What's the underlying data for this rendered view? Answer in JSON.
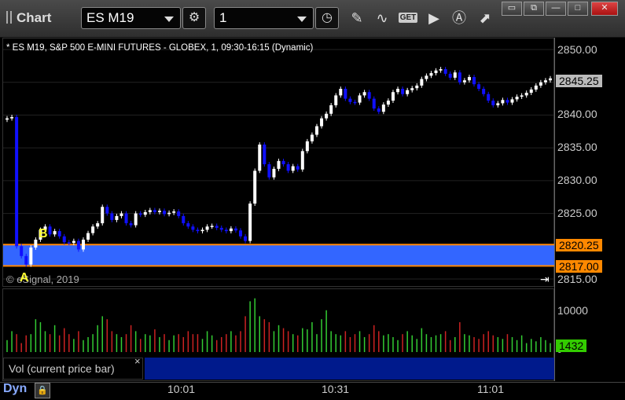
{
  "app": {
    "title": "Chart"
  },
  "toolbar": {
    "symbol": "ES M19",
    "interval": "1",
    "get_label": "GET"
  },
  "chart": {
    "description": "* ES M19, S&P 500 E-MINI FUTURES - GLOBEX, 1, 09:30-16:15 (Dynamic)",
    "copyright": "© eSignal, 2019",
    "price_ticks": [
      "2850.00",
      "2845.00",
      "2840.00",
      "2835.00",
      "2830.00",
      "2825.00",
      "2820.00",
      "2815.00"
    ],
    "last_price": "2845.25",
    "upper_band_price": "2820.25",
    "lower_band_price": "2817.00",
    "label_a": "A",
    "label_b": "B",
    "colors": {
      "up_candle": "#ffffff",
      "down_candle": "#1010ff",
      "band_fill": "#3366ff",
      "band_line": "#ff8800",
      "last_price_tag": "#bbbbbb",
      "band_tag": "#ff8800"
    }
  },
  "volume": {
    "label": "Vol (current price bar)",
    "close_icon": "×",
    "ticks": [
      "10000",
      "0"
    ],
    "current_value": "1432",
    "colors": {
      "up": "#33cc33",
      "down": "#cc2222",
      "current_tag": "#33cc00"
    }
  },
  "time_axis": {
    "labels": [
      "10:01",
      "10:31",
      "11:01"
    ]
  },
  "bottom": {
    "mode": "Dyn"
  },
  "chart_data": {
    "type": "candlestick",
    "y_range": [
      2815,
      2850
    ],
    "interval_minutes": 1,
    "closes": [
      2839.5,
      2839.7,
      2820,
      2818.5,
      2817.2,
      2819.8,
      2821,
      2822.5,
      2823,
      2821.8,
      2822.3,
      2821.5,
      2820.6,
      2820.5,
      2820.8,
      2819.5,
      2821,
      2822,
      2823,
      2823.5,
      2826,
      2825,
      2824,
      2824.6,
      2825,
      2823.5,
      2823.2,
      2825,
      2824.8,
      2825.2,
      2825.5,
      2825.2,
      2825.4,
      2824.9,
      2825.1,
      2825.3,
      2824.6,
      2823.5,
      2823,
      2822.5,
      2822.3,
      2822.5,
      2823,
      2823.1,
      2822.8,
      2822.5,
      2822.3,
      2822.7,
      2822.4,
      2821.5,
      2820.8,
      2826.5,
      2831.5,
      2835.5,
      2832.5,
      2830.5,
      2831.8,
      2833,
      2832.5,
      2831.5,
      2832.2,
      2831.7,
      2834.5,
      2836,
      2837,
      2838.3,
      2839.5,
      2840.2,
      2841.5,
      2843,
      2844,
      2842.5,
      2842,
      2841.9,
      2843,
      2843.5,
      2842.5,
      2841,
      2840.5,
      2841.6,
      2842.2,
      2843.5,
      2844,
      2843.2,
      2843.8,
      2844.1,
      2844.5,
      2845.5,
      2846,
      2846.4,
      2846.8,
      2847,
      2846.3,
      2845.7,
      2846.5,
      2845,
      2845.3,
      2845.8,
      2844.7,
      2844,
      2843.2,
      2842.2,
      2841.5,
      2841.8,
      2842.3,
      2841.9,
      2842.4,
      2842.8,
      2843,
      2843.4,
      2843.9,
      2844.5,
      2845,
      2845.3,
      2845.6
    ],
    "volume_relative": [
      0.2,
      0.35,
      0.3,
      0.15,
      0.28,
      0.3,
      0.55,
      0.5,
      0.35,
      0.3,
      0.45,
      0.28,
      0.4,
      0.3,
      0.22,
      0.35,
      0.2,
      0.25,
      0.3,
      0.45,
      0.6,
      0.55,
      0.35,
      0.3,
      0.25,
      0.3,
      0.45,
      0.35,
      0.22,
      0.3,
      0.28,
      0.38,
      0.25,
      0.3,
      0.2,
      0.28,
      0.3,
      0.25,
      0.35,
      0.3,
      0.3,
      0.22,
      0.35,
      0.28,
      0.2,
      0.25,
      0.3,
      0.35,
      0.28,
      0.35,
      0.6,
      0.85,
      0.9,
      0.6,
      0.55,
      0.5,
      0.35,
      0.45,
      0.4,
      0.35,
      0.3,
      0.28,
      0.4,
      0.38,
      0.5,
      0.3,
      0.55,
      0.7,
      0.35,
      0.3,
      0.28,
      0.35,
      0.25,
      0.3,
      0.35,
      0.25,
      0.3,
      0.45,
      0.35,
      0.28,
      0.3,
      0.25,
      0.2,
      0.3,
      0.35,
      0.28,
      0.22,
      0.4,
      0.3,
      0.25,
      0.28,
      0.3,
      0.35,
      0.2,
      0.25,
      0.5,
      0.3,
      0.28,
      0.25,
      0.22,
      0.3,
      0.35,
      0.28,
      0.25,
      0.22,
      0.3,
      0.25,
      0.2,
      0.28,
      0.15,
      0.22,
      0.18,
      0.25,
      0.2,
      0.15
    ],
    "band": [
      2817.0,
      2820.25
    ],
    "last_volume": 1432
  }
}
